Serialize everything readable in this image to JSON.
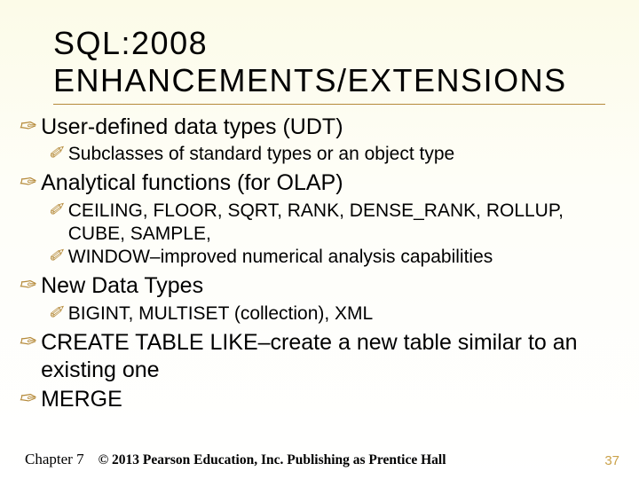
{
  "title_line1": "SQL:2008",
  "title_line2": "ENHANCEMENTS/EXTENSIONS",
  "bullets": [
    {
      "text": "User-defined data types (UDT)",
      "sub": [
        "Subclasses of standard types or an object type"
      ]
    },
    {
      "text": "Analytical functions (for OLAP)",
      "sub": [
        "CEILING, FLOOR, SQRT, RANK, DENSE_RANK, ROLLUP, CUBE, SAMPLE,",
        "WINDOW–improved numerical analysis capabilities"
      ]
    },
    {
      "text": "New Data Types",
      "sub": [
        "BIGINT, MULTISET (collection), XML"
      ]
    },
    {
      "text": "CREATE TABLE LIKE–create a new table similar to an existing one",
      "sub": []
    },
    {
      "text": "MERGE",
      "sub": []
    }
  ],
  "footer": {
    "chapter": "Chapter 7",
    "copyright": "© 2013 Pearson Education, Inc.  Publishing as Prentice Hall"
  },
  "page_number": "37",
  "glyphs": {
    "main": "✑",
    "sub": "✐"
  }
}
